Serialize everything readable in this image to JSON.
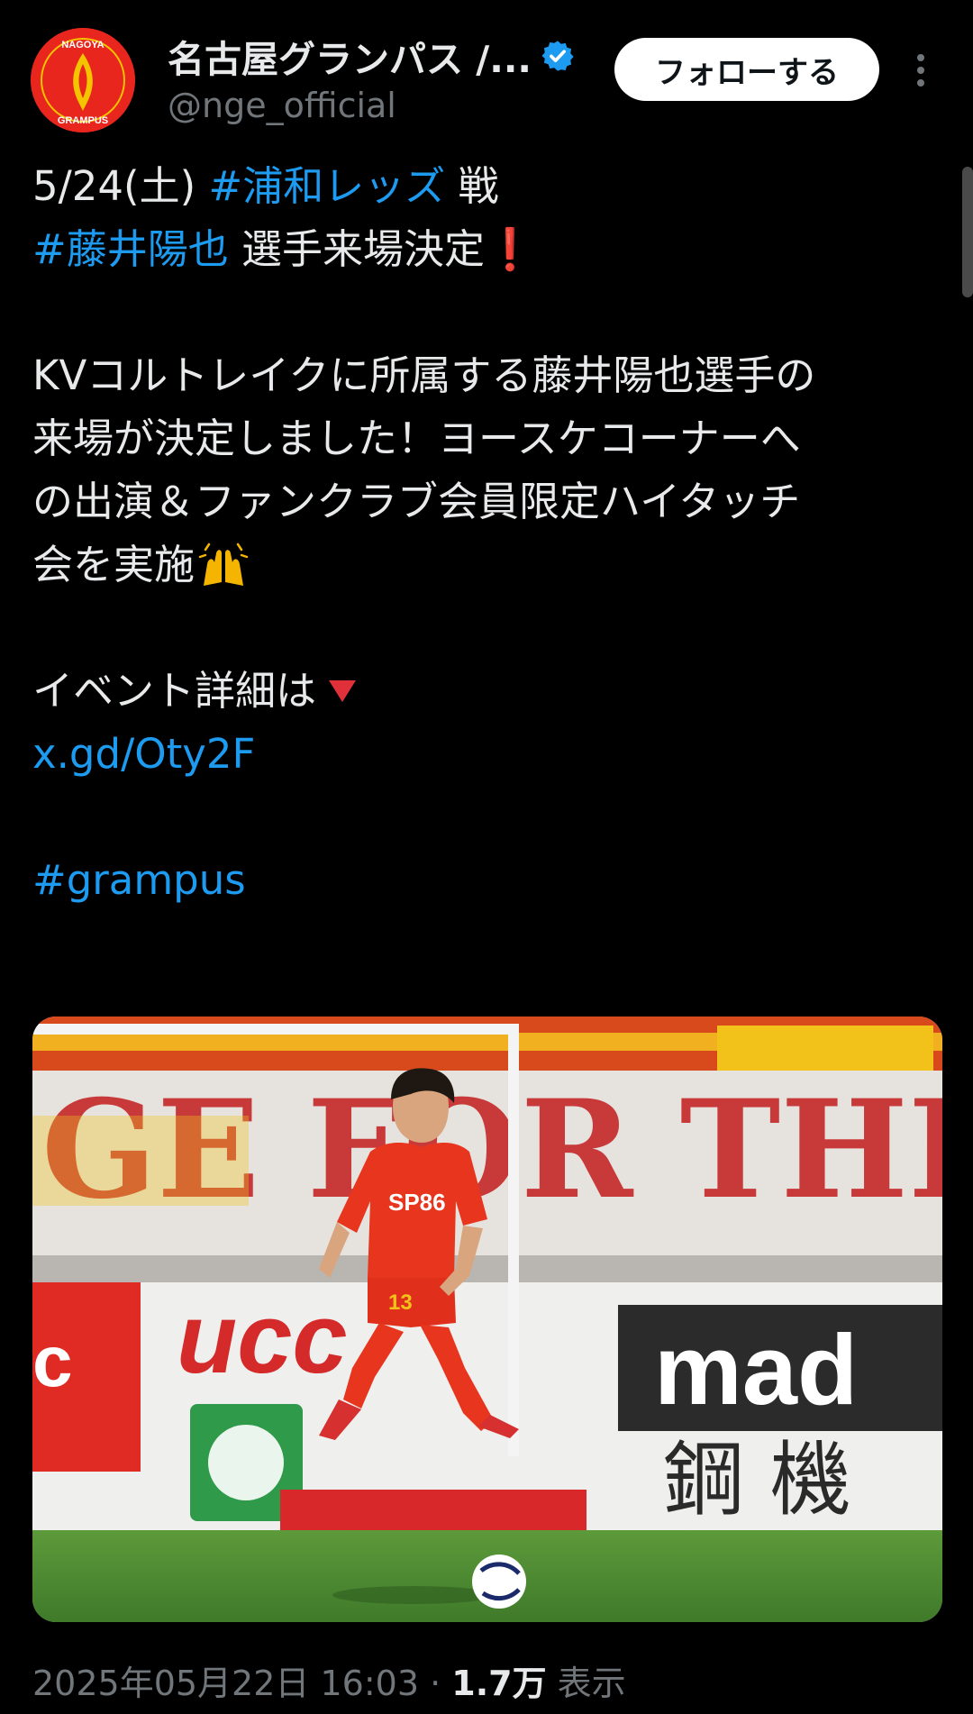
{
  "header": {
    "display_name": "名古屋グランパス /...",
    "handle": "@nge_official",
    "follow_label": "フォローする",
    "avatar_text_top": "NAGOYA",
    "avatar_text_bottom": "GRAMPUS"
  },
  "tweet": {
    "line1_date": "5/24(土) ",
    "line1_tag": "#浦和レッズ",
    "line1_rest": " 戦",
    "line2_tag": "#藤井陽也",
    "line2_rest": " 選手来場決定",
    "line2_excl": "❗",
    "body_line1": "KVコルトレイクに所属する藤井陽也選手の",
    "body_line2": "来場が決定しました！ヨースケコーナーへ",
    "body_line3": "の出演＆ファンクラブ会員限定ハイタッチ",
    "body_line4": "会を実施",
    "event_line": "イベント詳細は",
    "link": "x.gd/Oty2F",
    "hashtag": "#grampus"
  },
  "media": {
    "banner_text": "GE FOR THE",
    "sponsor_ucc": "ucc",
    "sponsor_mad": "mad",
    "sign_text": "鋼 機",
    "shirt_text": "SP86",
    "shirt_number": "13"
  },
  "footer": {
    "datetime": "2025年05月22日 16:03",
    "separator": " · ",
    "views": "1.7万",
    "views_label": " 表示"
  },
  "colors": {
    "background": "#000000",
    "text": "#e7e9ea",
    "muted": "#71767b",
    "link": "#1d9bf0",
    "verified": "#1d9bf0",
    "grampus_red": "#e8261e"
  },
  "icons": [
    "verified-badge-icon",
    "more-options-icon",
    "exclamation-icon",
    "down-triangle-icon",
    "raised-hands-icon"
  ]
}
